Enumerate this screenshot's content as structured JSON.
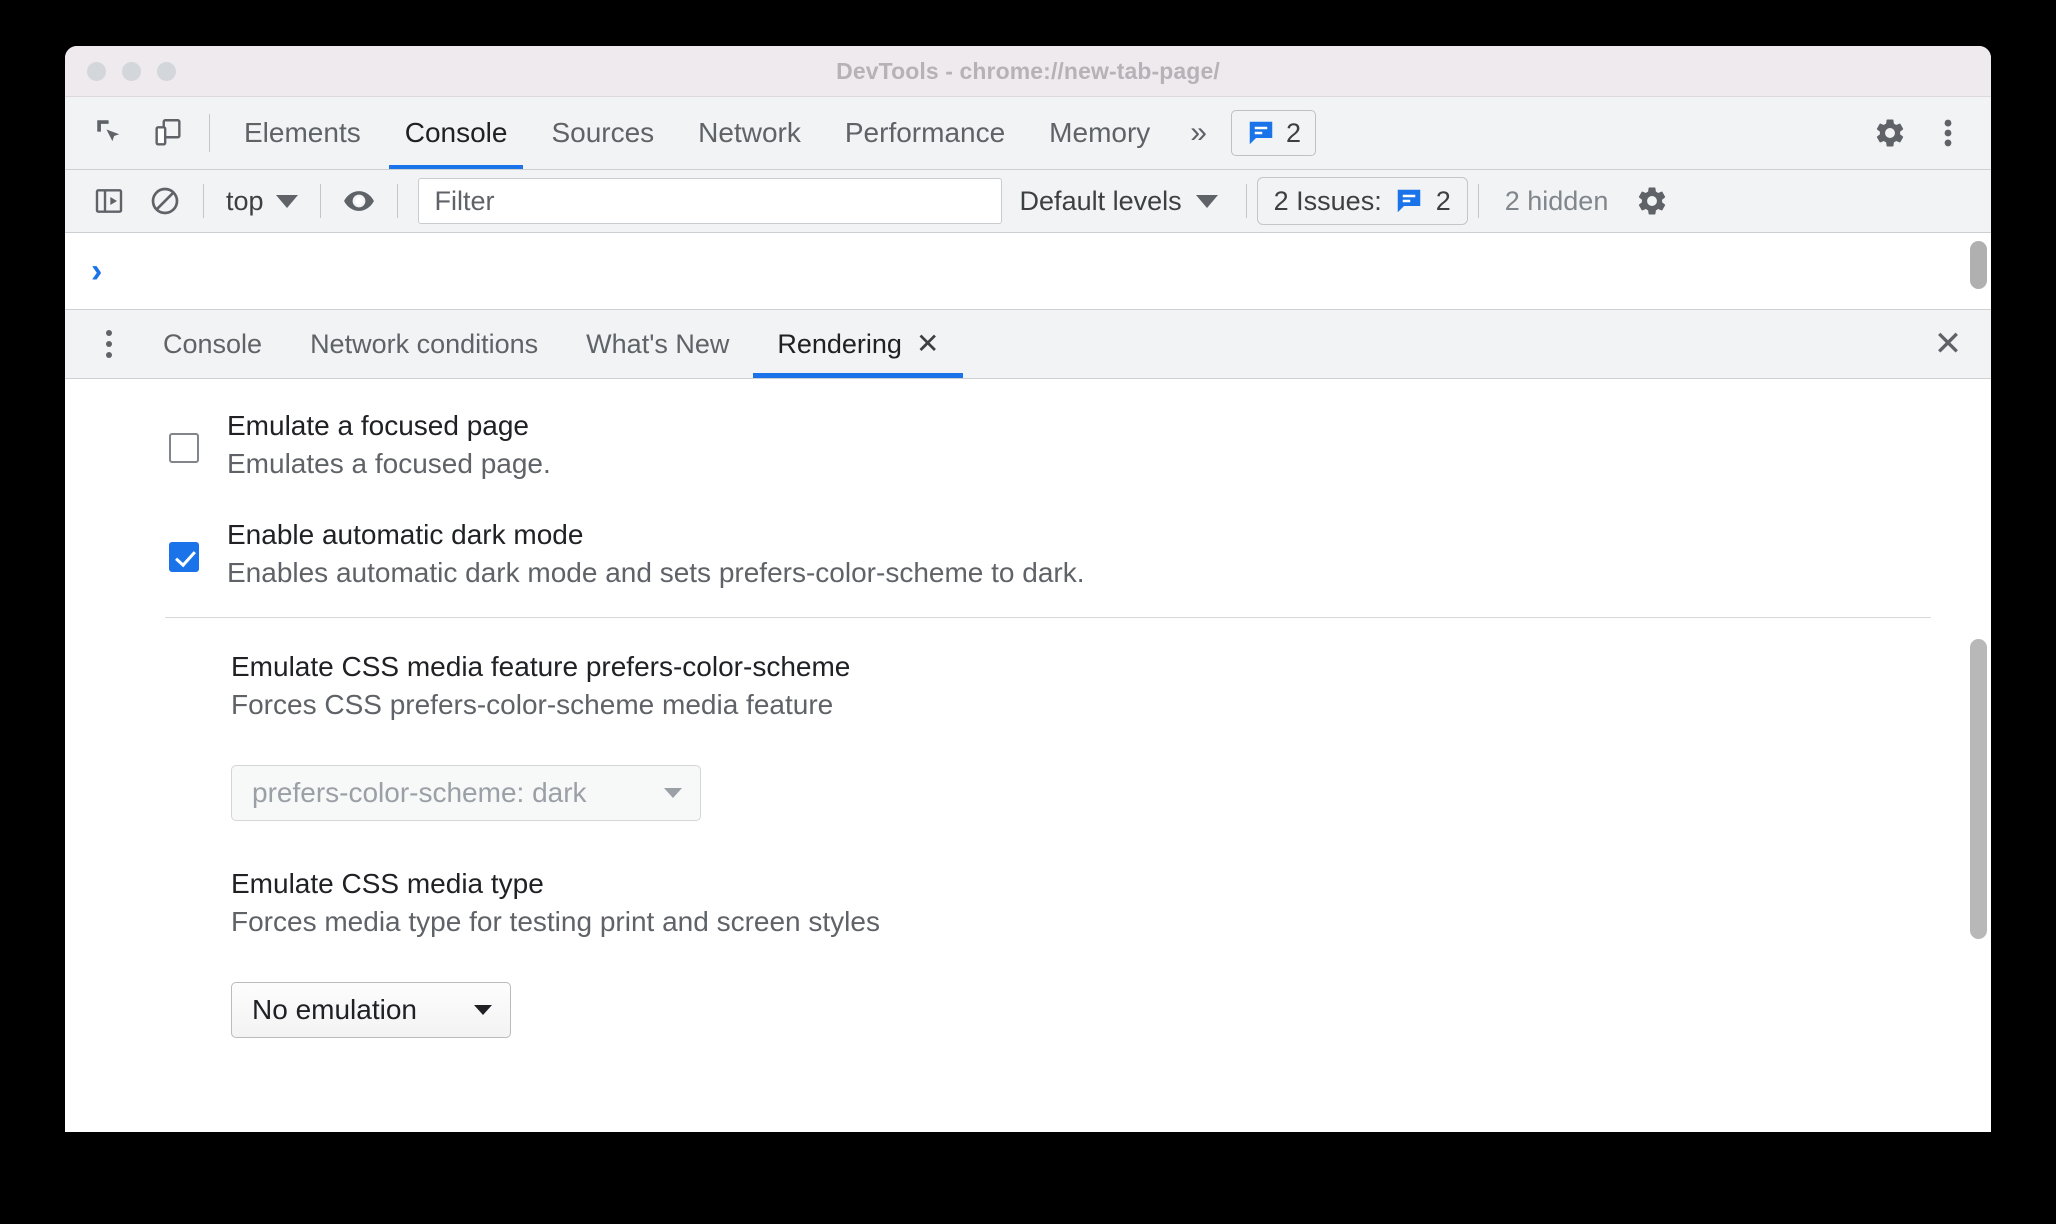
{
  "window": {
    "title": "DevTools - chrome://new-tab-page/"
  },
  "main_tabs": {
    "inspect_icon": "inspect-cursor-icon",
    "device_icon": "device-toolbar-icon",
    "items": [
      {
        "label": "Elements",
        "selected": false
      },
      {
        "label": "Console",
        "selected": true
      },
      {
        "label": "Sources",
        "selected": false
      },
      {
        "label": "Network",
        "selected": false
      },
      {
        "label": "Performance",
        "selected": false
      },
      {
        "label": "Memory",
        "selected": false
      }
    ],
    "more_label": "»",
    "issues_count": "2",
    "settings_icon": "gear-icon",
    "more_options_icon": "kebab-icon"
  },
  "console_toolbar": {
    "sidebar_icon": "console-sidebar-icon",
    "clear_icon": "clear-console-icon",
    "context": "top",
    "eye_icon": "live-expression-icon",
    "filter_placeholder": "Filter",
    "filter_value": "",
    "levels": "Default levels",
    "issues_label": "2 Issues:",
    "issues_count": "2",
    "hidden_label": "2 hidden",
    "settings_icon": "gear-icon"
  },
  "console_output": {
    "prompt": "›"
  },
  "drawer": {
    "kebab_icon": "drawer-more-tabs-icon",
    "tabs": [
      {
        "label": "Console",
        "selected": false,
        "closeable": false
      },
      {
        "label": "Network conditions",
        "selected": false,
        "closeable": false
      },
      {
        "label": "What's New",
        "selected": false,
        "closeable": false
      },
      {
        "label": "Rendering",
        "selected": true,
        "closeable": true,
        "close_glyph": "✕"
      }
    ],
    "close_glyph": "✕"
  },
  "rendering": {
    "checkbox_settings": [
      {
        "title": "Emulate a focused page",
        "desc": "Emulates a focused page.",
        "checked": false
      },
      {
        "title": "Enable automatic dark mode",
        "desc": "Enables automatic dark mode and sets prefers-color-scheme to dark.",
        "checked": true
      }
    ],
    "select_settings": [
      {
        "title": "Emulate CSS media feature prefers-color-scheme",
        "desc": "Forces CSS prefers-color-scheme media feature",
        "value": "prefers-color-scheme: dark",
        "disabled": true
      },
      {
        "title": "Emulate CSS media type",
        "desc": "Forces media type for testing print and screen styles",
        "value": "No emulation",
        "disabled": false
      }
    ]
  },
  "colors": {
    "accent": "#1a73e8",
    "titlebar": "#efeaee",
    "toolbar": "#f1f3f4",
    "text_primary": "#202124",
    "text_secondary": "#5f6368"
  }
}
